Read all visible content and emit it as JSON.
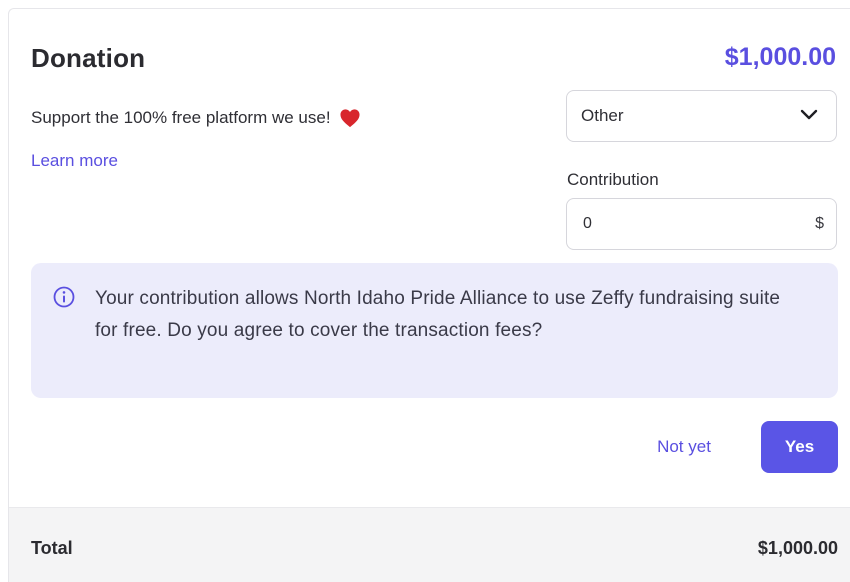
{
  "donation": {
    "title": "Donation",
    "amount": "$1,000.00",
    "support_text": "Support the 100% free platform we use!",
    "learn_more": "Learn more",
    "frequency_select": {
      "value": "Other"
    },
    "contribution": {
      "label": "Contribution",
      "value": "0",
      "currency": "$"
    },
    "info": {
      "text": "Your contribution allows North Idaho Pride Alliance to use Zeffy fundraising suite for free. Do you agree to cover the transaction fees?"
    },
    "actions": {
      "not_yet": "Not yet",
      "yes": "Yes"
    }
  },
  "footer": {
    "total_label": "Total",
    "total_value": "$1,000.00"
  },
  "icons": {
    "heart": "heart-icon",
    "chevron": "chevron-down-icon",
    "info": "info-icon"
  },
  "colors": {
    "accent": "#5a4fe0",
    "button": "#5a55e6",
    "info_bg": "#ececfb",
    "heart": "#d8262c",
    "footer_bg": "#f4f4f5"
  }
}
